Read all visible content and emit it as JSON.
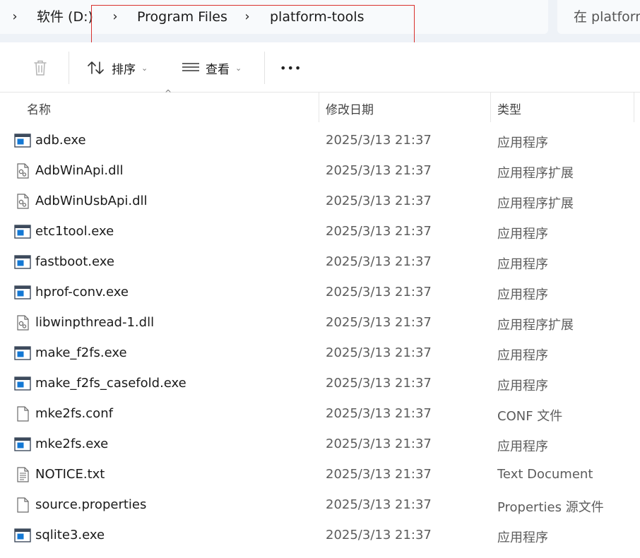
{
  "address": {
    "crumbs": [
      "软件 (D:)",
      "Program Files",
      "platform-tools"
    ],
    "search_placeholder": "在 platform-tools 中搜索"
  },
  "toolbar": {
    "sort_label": "排序",
    "view_label": "查看",
    "more_label": "•••"
  },
  "columns": {
    "name": "名称",
    "date": "修改日期",
    "type": "类型"
  },
  "files": [
    {
      "name": "adb.exe",
      "date": "2025/3/13 21:37",
      "type": "应用程序",
      "icon": "exe"
    },
    {
      "name": "AdbWinApi.dll",
      "date": "2025/3/13 21:37",
      "type": "应用程序扩展",
      "icon": "dll"
    },
    {
      "name": "AdbWinUsbApi.dll",
      "date": "2025/3/13 21:37",
      "type": "应用程序扩展",
      "icon": "dll"
    },
    {
      "name": "etc1tool.exe",
      "date": "2025/3/13 21:37",
      "type": "应用程序",
      "icon": "exe"
    },
    {
      "name": "fastboot.exe",
      "date": "2025/3/13 21:37",
      "type": "应用程序",
      "icon": "exe"
    },
    {
      "name": "hprof-conv.exe",
      "date": "2025/3/13 21:37",
      "type": "应用程序",
      "icon": "exe"
    },
    {
      "name": "libwinpthread-1.dll",
      "date": "2025/3/13 21:37",
      "type": "应用程序扩展",
      "icon": "dll"
    },
    {
      "name": "make_f2fs.exe",
      "date": "2025/3/13 21:37",
      "type": "应用程序",
      "icon": "exe"
    },
    {
      "name": "make_f2fs_casefold.exe",
      "date": "2025/3/13 21:37",
      "type": "应用程序",
      "icon": "exe"
    },
    {
      "name": "mke2fs.conf",
      "date": "2025/3/13 21:37",
      "type": "CONF 文件",
      "icon": "file"
    },
    {
      "name": "mke2fs.exe",
      "date": "2025/3/13 21:37",
      "type": "应用程序",
      "icon": "exe"
    },
    {
      "name": "NOTICE.txt",
      "date": "2025/3/13 21:37",
      "type": "Text Document",
      "icon": "txt"
    },
    {
      "name": "source.properties",
      "date": "2025/3/13 21:37",
      "type": "Properties 源文件",
      "icon": "file"
    },
    {
      "name": "sqlite3.exe",
      "date": "2025/3/13 21:37",
      "type": "应用程序",
      "icon": "exe"
    }
  ]
}
